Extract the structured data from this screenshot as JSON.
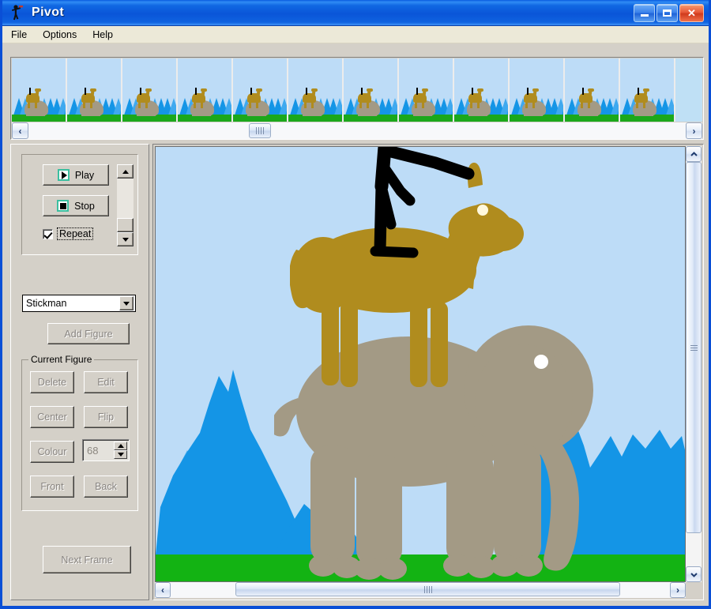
{
  "window": {
    "title": "Pivot",
    "app_icon": "stickman-icon",
    "controls": {
      "minimize": "minimize-button",
      "maximize": "maximize-button",
      "close": "close-button"
    }
  },
  "menu": {
    "items": [
      {
        "label": "File"
      },
      {
        "label": "Options"
      },
      {
        "label": "Help"
      }
    ]
  },
  "filmstrip": {
    "frame_count": 12,
    "scroll": {
      "left_arrow": "‹",
      "right_arrow": "›",
      "thumb_position_pct": 32
    }
  },
  "controls": {
    "playback": {
      "play_label": "Play",
      "stop_label": "Stop",
      "repeat_label": "Repeat",
      "repeat_checked": true,
      "speed_scroll": "speed-scrollbar"
    },
    "figure_select": {
      "value": "Stickman",
      "options": [
        "Stickman"
      ]
    },
    "add_figure_label": "Add Figure",
    "current_figure": {
      "legend": "Current Figure",
      "delete_label": "Delete",
      "edit_label": "Edit",
      "center_label": "Center",
      "flip_label": "Flip",
      "colour_label": "Colour",
      "colour_value": "68",
      "front_label": "Front",
      "back_label": "Back"
    },
    "next_frame_label": "Next Frame"
  },
  "canvas": {
    "scene_name": "elephant-horse-stickman-scene",
    "colors": {
      "sky": "#BDDCF7",
      "ground": "#13B313",
      "mountain_front": "#1495E6",
      "mountain_back": "#4FB2F0",
      "elephant": "#A39A85",
      "horse": "#B08C1E",
      "stickman": "#000000",
      "eye": "#FFFFFF"
    },
    "figures": [
      {
        "name": "elephant",
        "colour": "#A39A85"
      },
      {
        "name": "horse",
        "colour": "#B08C1E"
      },
      {
        "name": "stickman",
        "colour": "#000000"
      }
    ],
    "vscroll": {
      "up_arrow": "▲",
      "down_arrow": "▼"
    },
    "hscroll": {
      "left_arrow": "‹",
      "right_arrow": "›"
    }
  }
}
